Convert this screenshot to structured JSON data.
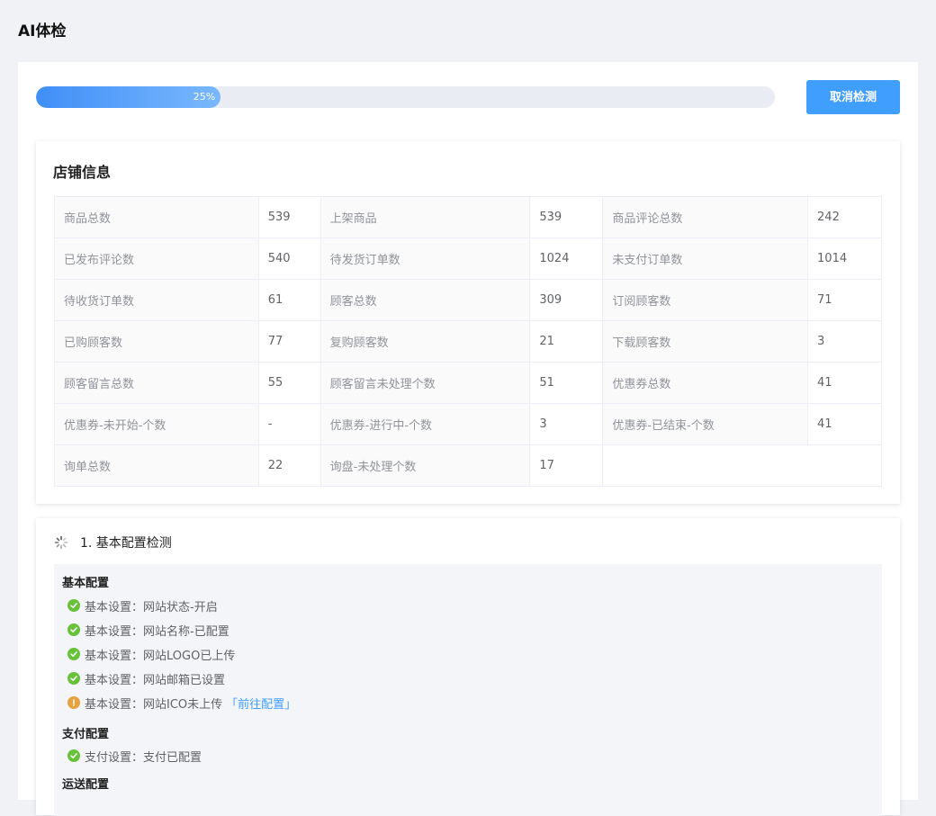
{
  "page": {
    "title": "AI体检"
  },
  "progress": {
    "percent": 25,
    "label": "25%"
  },
  "toolbar": {
    "cancel_label": "取消检测"
  },
  "colors": {
    "accent": "#409eff",
    "success": "#67c23a",
    "warning": "#e6a23c"
  },
  "store": {
    "title": "店铺信息",
    "rows": [
      [
        [
          "商品总数",
          "539"
        ],
        [
          "上架商品",
          "539"
        ],
        [
          "商品评论总数",
          "242"
        ]
      ],
      [
        [
          "已发布评论数",
          "540"
        ],
        [
          "待发货订单数",
          "1024"
        ],
        [
          "未支付订单数",
          "1014"
        ]
      ],
      [
        [
          "待收货订单数",
          "61"
        ],
        [
          "顾客总数",
          "309"
        ],
        [
          "订阅顾客数",
          "71"
        ]
      ],
      [
        [
          "已购顾客数",
          "77"
        ],
        [
          "复购顾客数",
          "21"
        ],
        [
          "下载顾客数",
          "3"
        ]
      ],
      [
        [
          "顾客留言总数",
          "55"
        ],
        [
          "顾客留言未处理个数",
          "51"
        ],
        [
          "优惠券总数",
          "41"
        ]
      ],
      [
        [
          "优惠券-未开始-个数",
          "-"
        ],
        [
          "优惠券-进行中-个数",
          "3"
        ],
        [
          "优惠券-已结束-个数",
          "41"
        ]
      ],
      [
        [
          "询单总数",
          "22"
        ],
        [
          "询盘-未处理个数",
          "17"
        ]
      ]
    ]
  },
  "check": {
    "title": "1. 基本配置检测",
    "icon": "loading-spinner-icon",
    "sections": [
      {
        "title": "基本配置",
        "items": [
          {
            "status": "ok",
            "icon": "check-circle-icon",
            "text": "基本设置：网站状态-开启"
          },
          {
            "status": "ok",
            "icon": "check-circle-icon",
            "text": "基本设置：网站名称-已配置"
          },
          {
            "status": "ok",
            "icon": "check-circle-icon",
            "text": "基本设置：网站LOGO已上传"
          },
          {
            "status": "ok",
            "icon": "check-circle-icon",
            "text": "基本设置：网站邮箱已设置"
          },
          {
            "status": "warn",
            "icon": "warning-circle-icon",
            "text": "基本设置：网站ICO未上传",
            "link": "「前往配置」"
          }
        ]
      },
      {
        "title": "支付配置",
        "items": [
          {
            "status": "ok",
            "icon": "check-circle-icon",
            "text": "支付设置：支付已配置"
          }
        ]
      },
      {
        "title": "运送配置",
        "items": []
      }
    ]
  }
}
